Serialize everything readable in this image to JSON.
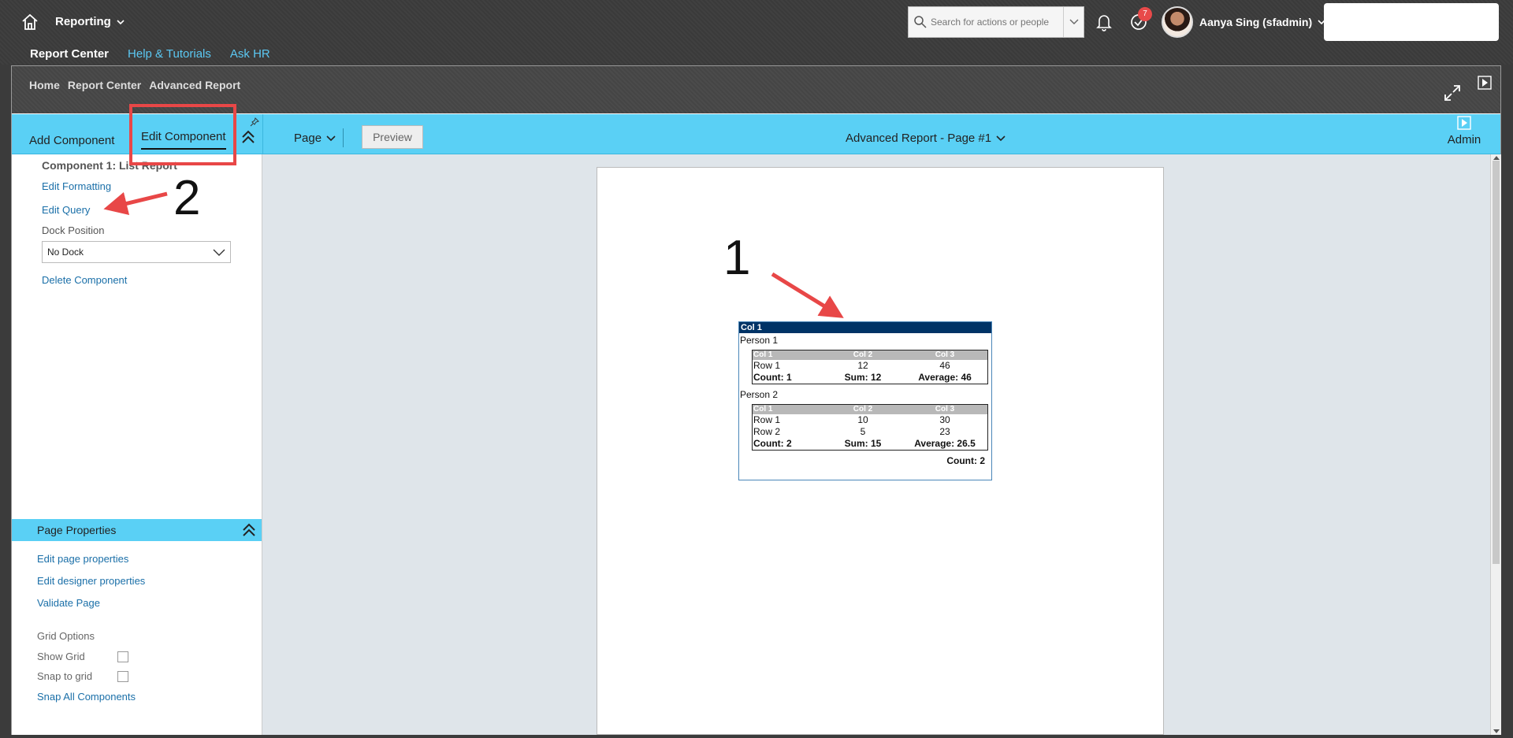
{
  "shell": {
    "product": "Reporting",
    "search_placeholder": "Search for actions or people",
    "notifications_badge": "7",
    "user_name": "Aanya Sing (sfadmin)",
    "subnav": [
      "Report Center",
      "Help & Tutorials",
      "Ask HR"
    ]
  },
  "breadcrumbs": [
    "Home",
    "Report Center",
    "Advanced Report"
  ],
  "toolbar": {
    "tab_add": "Add Component",
    "tab_edit": "Edit Component",
    "page_menu": "Page",
    "preview": "Preview",
    "page_title": "Advanced Report - Page #1",
    "admin": "Admin"
  },
  "left_panel": {
    "component_title": "Component 1: List Report",
    "edit_formatting": "Edit Formatting",
    "edit_query": "Edit Query",
    "dock_position_label": "Dock Position",
    "dock_value": "No Dock",
    "delete_component": "Delete Component"
  },
  "page_properties": {
    "header": "Page Properties",
    "edit_page_properties": "Edit page properties",
    "edit_designer_properties": "Edit designer properties",
    "validate_page": "Validate Page",
    "grid_options": "Grid Options",
    "show_grid": "Show Grid",
    "snap_to_grid": "Snap to grid",
    "snap_all": "Snap All Components"
  },
  "report": {
    "header": "Col 1",
    "groups": [
      {
        "name": "Person 1",
        "columns": [
          "Col 1",
          "Col 2",
          "Col 3"
        ],
        "rows": [
          [
            "Row 1",
            "12",
            "46"
          ]
        ],
        "totals": [
          "Count: 1",
          "Sum: 12",
          "Average: 46"
        ]
      },
      {
        "name": "Person 2",
        "columns": [
          "Col 1",
          "Col 2",
          "Col 3"
        ],
        "rows": [
          [
            "Row 1",
            "10",
            "30"
          ],
          [
            "Row 2",
            "5",
            "23"
          ]
        ],
        "totals": [
          "Count: 2",
          "Sum: 15",
          "Average: 26.5"
        ]
      }
    ],
    "grand_total": "Count: 2"
  },
  "annotations": {
    "one": "1",
    "two": "2"
  },
  "colors": {
    "accent": "#5ad0f5",
    "annotation": "#e84747",
    "report_header": "#003366"
  }
}
